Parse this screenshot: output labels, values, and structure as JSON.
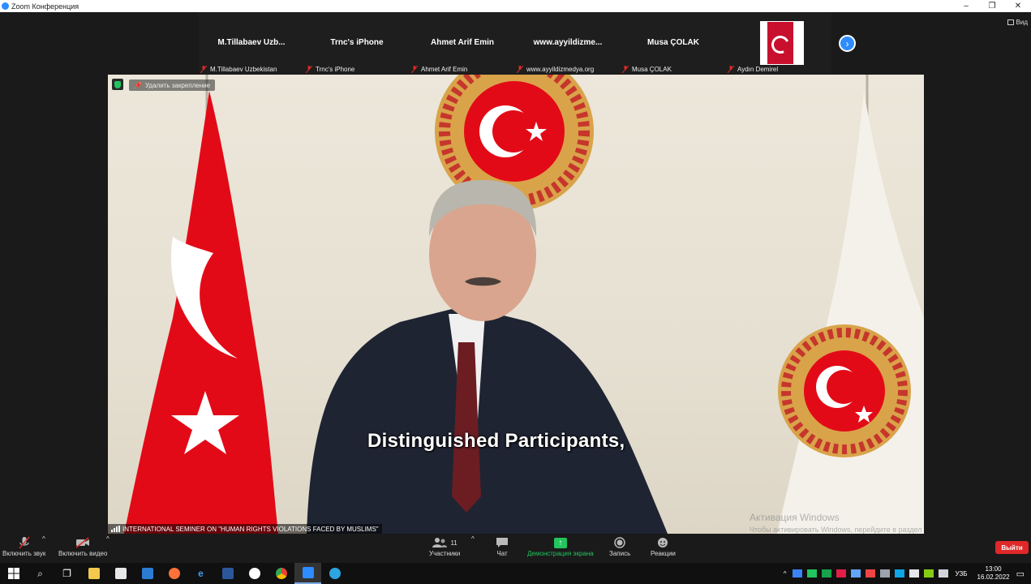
{
  "window": {
    "title": "Zoom Конференция",
    "controls": [
      "–",
      "❐",
      "✕"
    ],
    "view_label": "Вид"
  },
  "gallery": [
    {
      "name": "M.Tillabaev  Uzb...",
      "label": "M.Tillabaev Uzbekistan"
    },
    {
      "name": "Trnc's iPhone",
      "label": "Trnc's iPhone"
    },
    {
      "name": "Ahmet Arif Emin",
      "label": "Ahmet Arif Emin"
    },
    {
      "name": "www.ayyildizme...",
      "label": "www.ayyildizmedya.org"
    },
    {
      "name": "Musa ÇOLAK",
      "label": "Musa ÇOLAK"
    },
    {
      "name": "",
      "label": "Aydın Demirel"
    }
  ],
  "video": {
    "unpin_label": "Удалить закрепление",
    "caption": "Distinguished Participants,",
    "lower_third": "INTERNATIONAL SEMINER ON \"HUMAN RIGHTS VIOLATIONS FACED BY MUSLIMS\"",
    "activation_title": "Активация Windows",
    "activation_text": "Чтобы активировать Windows, перейдите в раздел \"Параметры\"."
  },
  "toolbar": {
    "audio": "Включить звук",
    "video": "Включить видео",
    "participants": "Участники",
    "participants_count": "11",
    "chat": "Чат",
    "share": "Демонстрация экрана",
    "record": "Запись",
    "reactions": "Реакции",
    "leave": "Выйти"
  },
  "taskbar": {
    "lang": "УЗБ",
    "time": "13:00",
    "date": "16.02.2022"
  },
  "colors": {
    "zoom_blue": "#2d8cff",
    "share_green": "#22c55e",
    "leave_red": "#e02828",
    "flag_red": "#e30a17"
  }
}
